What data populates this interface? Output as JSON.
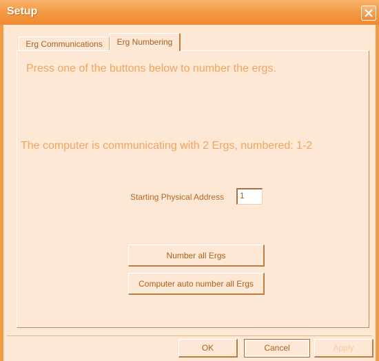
{
  "window": {
    "title": "Setup",
    "accent_color": "#f39a45",
    "background_color": "#fce8d4"
  },
  "tabs": [
    {
      "label": "Erg Communications",
      "active": false
    },
    {
      "label": "Erg Numbering",
      "active": true
    }
  ],
  "panel": {
    "instruction": "Press one of the buttons below to number the ergs.",
    "status": "The computer is communicating with 2 Ergs, numbered:  1-2",
    "address_label": "Starting Physical Address",
    "address_value": "1",
    "number_all_label": "Number all Ergs",
    "auto_number_label": "Computer auto number all Ergs"
  },
  "footer": {
    "ok_label": "OK",
    "cancel_label": "Cancel",
    "apply_label": "Apply"
  },
  "icons": {
    "close": "close-icon"
  }
}
